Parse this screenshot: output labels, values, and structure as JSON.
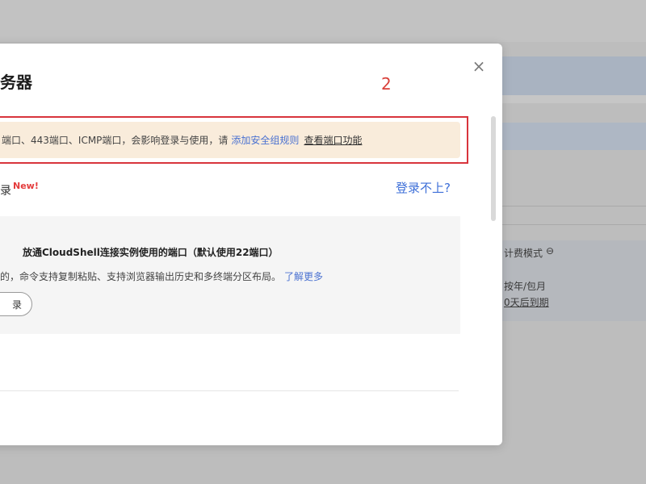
{
  "modal": {
    "title": "服务器",
    "close_icon": "×",
    "step_number": "2",
    "warning": {
      "text": "端口、443端口、ICMP端口，会影响登录与使用，请",
      "link_add_rule": "添加安全组规则",
      "link_view_port": "查看端口功能"
    },
    "login_method": {
      "label": "录",
      "badge": "New!"
    },
    "cant_login": "登录不上?",
    "cloudshell": {
      "title": "放通CloudShell连接实例使用的端口（默认使用22端口）",
      "description": "的，命令支持复制粘贴、支持浏览器输出历史和多终端分区布局。",
      "learn_more": "了解更多",
      "login_button": "录"
    }
  },
  "background": {
    "billing_mode": "计费模式",
    "billing_icon": "⊖",
    "billing_value": "按年/包月",
    "expire_text": "0天后到期"
  }
}
